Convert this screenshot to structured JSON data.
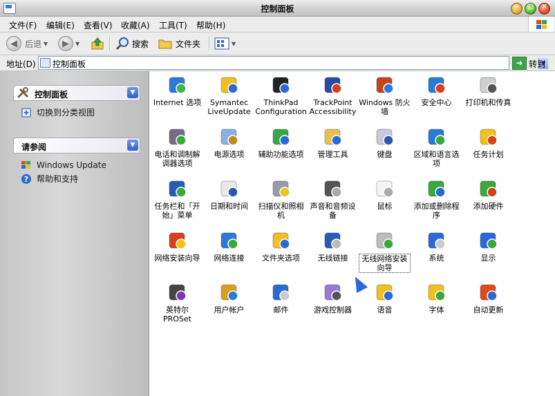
{
  "window": {
    "title": "控制面板"
  },
  "menu": [
    "文件(F)",
    "编辑(E)",
    "查看(V)",
    "收藏(A)",
    "工具(T)",
    "帮助(H)"
  ],
  "toolbar": {
    "back_label": "后退",
    "search_label": "搜索",
    "folders_label": "文件夹"
  },
  "address": {
    "label": "地址(D)",
    "value": "控制面板",
    "go_label": "转到"
  },
  "sidebar": {
    "panel1_title": "控制面板",
    "switch_view": "切换到分类视图",
    "panel2_title": "请参阅",
    "see_also": [
      "Windows Update",
      "帮助和支持"
    ]
  },
  "items": [
    {
      "label": "Internet 选项",
      "icon": "globe-check-icon"
    },
    {
      "label": "Symantec LiveUpdate",
      "icon": "symantec-icon"
    },
    {
      "label": "ThinkPad Configuration",
      "icon": "laptop-icon"
    },
    {
      "label": "TrackPoint Accessibility",
      "icon": "accessibility-icon"
    },
    {
      "label": "Windows 防火墙",
      "icon": "firewall-icon"
    },
    {
      "label": "安全中心",
      "icon": "shield-icon"
    },
    {
      "label": "打印机和传真",
      "icon": "printer-icon"
    },
    {
      "label": "电话和调制解调器选项",
      "icon": "phone-icon"
    },
    {
      "label": "电源选项",
      "icon": "power-icon"
    },
    {
      "label": "辅助功能选项",
      "icon": "wheelchair-icon"
    },
    {
      "label": "管理工具",
      "icon": "admin-tools-icon"
    },
    {
      "label": "键盘",
      "icon": "keyboard-icon"
    },
    {
      "label": "区域和语言选项",
      "icon": "globe-icon"
    },
    {
      "label": "任务计划",
      "icon": "scheduled-tasks-icon"
    },
    {
      "label": "任务栏和「开始」菜单",
      "icon": "taskbar-icon"
    },
    {
      "label": "日期和时间",
      "icon": "clock-icon"
    },
    {
      "label": "扫描仪和照相机",
      "icon": "scanner-icon"
    },
    {
      "label": "声音和音频设备",
      "icon": "speaker-icon"
    },
    {
      "label": "鼠标",
      "icon": "mouse-icon"
    },
    {
      "label": "添加或删除程序",
      "icon": "add-remove-icon"
    },
    {
      "label": "添加硬件",
      "icon": "hardware-icon"
    },
    {
      "label": "网络安装向导",
      "icon": "network-home-icon"
    },
    {
      "label": "网络连接",
      "icon": "network-globe-icon"
    },
    {
      "label": "文件夹选项",
      "icon": "folder-options-icon"
    },
    {
      "label": "无线链接",
      "icon": "wireless-link-icon"
    },
    {
      "label": "无线网络安装向导",
      "icon": "wireless-wizard-icon"
    },
    {
      "label": "系统",
      "icon": "system-icon"
    },
    {
      "label": "显示",
      "icon": "display-icon"
    },
    {
      "label": "英特尔 PROSet",
      "icon": "intel-icon"
    },
    {
      "label": "用户帐户",
      "icon": "users-icon"
    },
    {
      "label": "邮件",
      "icon": "mail-icon"
    },
    {
      "label": "游戏控制器",
      "icon": "gamepad-icon"
    },
    {
      "label": "语音",
      "icon": "speech-icon"
    },
    {
      "label": "字体",
      "icon": "fonts-icon"
    },
    {
      "label": "自动更新",
      "icon": "auto-update-icon"
    }
  ]
}
